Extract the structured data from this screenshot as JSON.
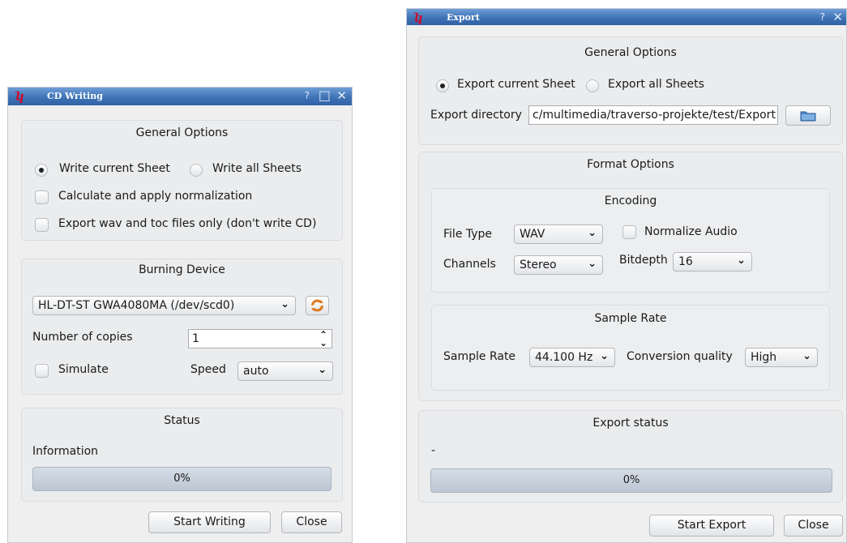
{
  "cd_writing": {
    "title": "CD Writing",
    "help": "?",
    "maximize": "□",
    "close_x": "✕",
    "general_options": {
      "heading": "General Options",
      "write_current_sheet": "Write current Sheet",
      "write_all_sheets": "Write all Sheets",
      "calculate_normalization": "Calculate and apply normalization",
      "export_wav_toc_only": "Export wav and toc files only (don't write CD)"
    },
    "burning_device": {
      "heading": "Burning Device",
      "device": "HL-DT-ST GWA4080MA  (/dev/scd0)",
      "copies_label": "Number of copies",
      "copies_value": "1",
      "simulate_label": "Simulate",
      "speed_label": "Speed",
      "speed_value": "auto"
    },
    "status": {
      "heading": "Status",
      "information": "Information",
      "progress_text": "0%",
      "progress": 0
    },
    "start_button": "Start Writing",
    "close_button": "Close"
  },
  "export": {
    "title": "Export",
    "help": "?",
    "close_x": "✕",
    "general_options": {
      "heading": "General Options",
      "export_current_sheet": "Export current Sheet",
      "export_all_sheets": "Export all Sheets",
      "directory_label": "Export directory",
      "directory_value": "c/multimedia/traverso-projekte/test/Export/"
    },
    "format_options": {
      "heading": "Format Options",
      "encoding": {
        "heading": "Encoding",
        "file_type_label": "File Type",
        "file_type_value": "WAV",
        "normalize_label": "Normalize Audio",
        "channels_label": "Channels",
        "channels_value": "Stereo",
        "bitdepth_label": "Bitdepth",
        "bitdepth_value": "16"
      },
      "sample_rate": {
        "heading": "Sample Rate",
        "rate_label": "Sample Rate",
        "rate_value": "44.100 Hz",
        "quality_label": "Conversion quality",
        "quality_value": "High"
      }
    },
    "export_status": {
      "heading": "Export status",
      "status_text": "-",
      "progress_text": "0%",
      "progress": 0
    },
    "start_button": "Start Export",
    "close_button": "Close"
  }
}
